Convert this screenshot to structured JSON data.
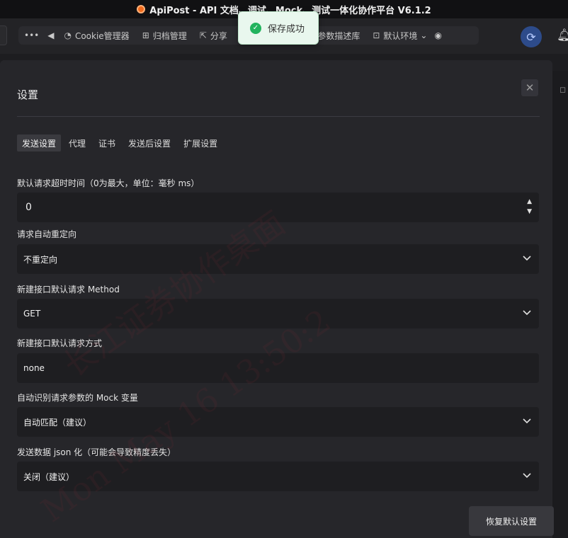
{
  "window": {
    "title": "ApiPost - API 文档、调试、Mock、测试一体化协作平台 V6.1.2"
  },
  "toolbar": {
    "items": [
      {
        "icon": "cookie-icon",
        "label": "Cookie管理器"
      },
      {
        "icon": "archive-icon",
        "label": "归档管理"
      },
      {
        "icon": "share-icon",
        "label": "分享"
      },
      {
        "icon": "cube-icon",
        "label": "参数描述库"
      },
      {
        "icon": "environment-icon",
        "label": "默认环境"
      }
    ]
  },
  "toast": {
    "message": "保存成功"
  },
  "modal": {
    "title": "设置",
    "tabs": [
      "发送设置",
      "代理",
      "证书",
      "发送后设置",
      "扩展设置"
    ],
    "fields": [
      {
        "label": "默认请求超时时间（0为最大，单位：毫秒 ms）",
        "value": "0"
      },
      {
        "label": "请求自动重定向",
        "value": "不重定向"
      },
      {
        "label": "新建接口默认请求 Method",
        "value": "GET"
      },
      {
        "label": "新建接口默认请求方式",
        "value": "none"
      },
      {
        "label": "自动识别请求参数的 Mock 变量",
        "value": "自动匹配（建议）"
      },
      {
        "label": "发送数据 json 化（可能会导致精度丢失）",
        "value": "关闭（建议）"
      }
    ],
    "reset_label": "恢复默认设置"
  },
  "watermark": {
    "lines": [
      "长江证券协作桌面",
      "Mon May 16 13:50:2"
    ]
  }
}
